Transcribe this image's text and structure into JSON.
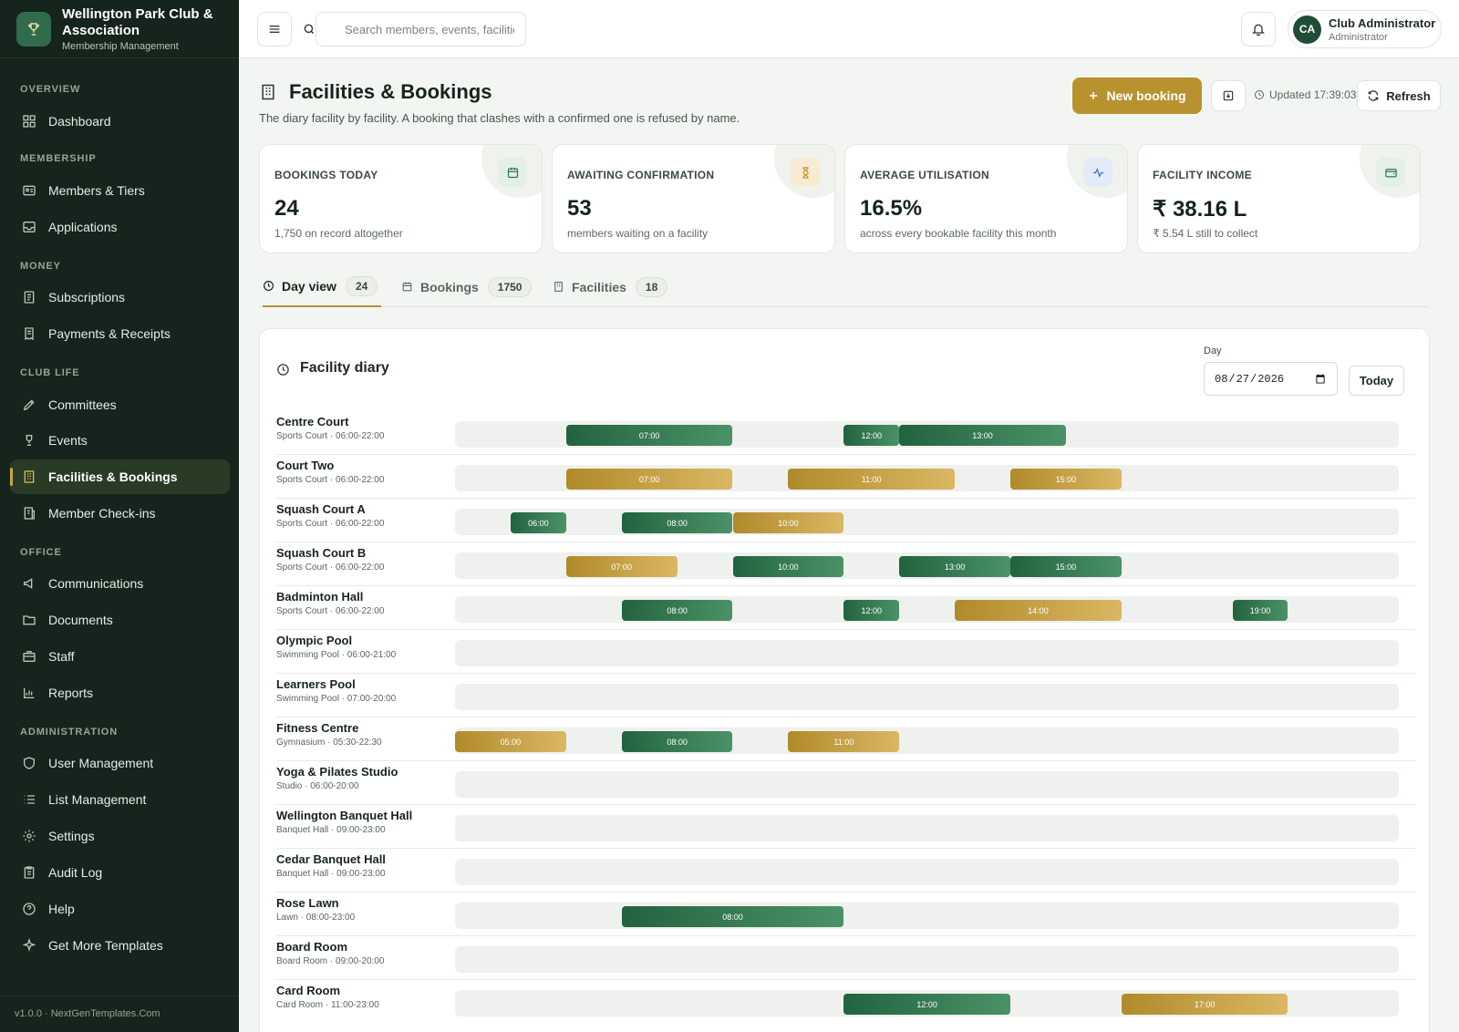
{
  "brand": {
    "name": "Wellington Park Club & Association",
    "subtitle": "Membership Management"
  },
  "nav": {
    "sections": [
      "OVERVIEW",
      "MEMBERSHIP",
      "MONEY",
      "CLUB LIFE",
      "OFFICE",
      "ADMINISTRATION"
    ],
    "items": [
      {
        "label": "Dashboard",
        "icon": "dashboard-icon"
      },
      {
        "label": "Members & Tiers",
        "icon": "id-card-icon"
      },
      {
        "label": "Applications",
        "icon": "inbox-icon"
      },
      {
        "label": "Subscriptions",
        "icon": "document-icon"
      },
      {
        "label": "Payments & Receipts",
        "icon": "receipt-icon"
      },
      {
        "label": "Committees",
        "icon": "pen-icon"
      },
      {
        "label": "Events",
        "icon": "trophy-icon"
      },
      {
        "label": "Facilities & Bookings",
        "icon": "building-icon",
        "active": true
      },
      {
        "label": "Member Check-ins",
        "icon": "check-in-icon"
      },
      {
        "label": "Communications",
        "icon": "megaphone-icon"
      },
      {
        "label": "Documents",
        "icon": "folder-icon"
      },
      {
        "label": "Staff",
        "icon": "briefcase-icon"
      },
      {
        "label": "Reports",
        "icon": "bar-chart-icon"
      },
      {
        "label": "User Management",
        "icon": "shield-icon"
      },
      {
        "label": "List Management",
        "icon": "list-icon"
      },
      {
        "label": "Settings",
        "icon": "gear-icon"
      },
      {
        "label": "Audit Log",
        "icon": "clipboard-icon"
      },
      {
        "label": "Help",
        "icon": "help-icon"
      },
      {
        "label": "Get More Templates",
        "icon": "sparkle-icon"
      }
    ],
    "footer": "v1.0.0 · NextGenTemplates.Com"
  },
  "topbar": {
    "search_placeholder": "Search members, events, facilities...",
    "user": {
      "initials": "CA",
      "name": "Club Administrator",
      "role": "Administrator"
    }
  },
  "page": {
    "title": "Facilities & Bookings",
    "subtitle": "The diary facility by facility. A booking that clashes with a confirmed one is refused by name.",
    "new_booking": "New booking",
    "updated": "Updated 17:39:03",
    "refresh": "Refresh"
  },
  "stats": [
    {
      "label": "BOOKINGS TODAY",
      "value": "24",
      "note": "1,750 on record altogether",
      "icon": "calendar-icon",
      "accent": "#2f7a52"
    },
    {
      "label": "AWAITING CONFIRMATION",
      "value": "53",
      "note": "members waiting on a facility",
      "icon": "hourglass-icon",
      "accent": "#c9982a"
    },
    {
      "label": "AVERAGE UTILISATION",
      "value": "16.5%",
      "note": "across every bookable facility this month",
      "icon": "activity-icon",
      "accent": "#3f6fd1"
    },
    {
      "label": "FACILITY INCOME",
      "value": "₹ 38.16 L",
      "note": "₹ 5.54 L still to collect",
      "icon": "wallet-icon",
      "accent": "#2f7a52"
    }
  ],
  "tabs": [
    {
      "label": "Day view",
      "count": "24",
      "icon": "clock-icon",
      "active": true
    },
    {
      "label": "Bookings",
      "count": "1750",
      "icon": "calendar-icon"
    },
    {
      "label": "Facilities",
      "count": "18",
      "icon": "building-icon"
    }
  ],
  "diary": {
    "title": "Facility diary",
    "day_label": "Day",
    "day_value": "2026-08-27",
    "today": "Today",
    "axis_start_hour": 5,
    "axis_end_hour": 22,
    "status_colors": {
      "confirmed": "#2f7a52",
      "pending": "#c9a23f"
    },
    "facilities": [
      {
        "name": "Centre Court",
        "meta": "Sports Court · 06:00-22:00",
        "bookings": [
          {
            "start": "07:00",
            "hours": 3,
            "status": "confirmed"
          },
          {
            "start": "12:00",
            "hours": 1,
            "status": "confirmed"
          },
          {
            "start": "13:00",
            "hours": 3,
            "status": "confirmed"
          }
        ]
      },
      {
        "name": "Court Two",
        "meta": "Sports Court · 06:00-22:00",
        "bookings": [
          {
            "start": "07:00",
            "hours": 3,
            "status": "pending"
          },
          {
            "start": "11:00",
            "hours": 3,
            "status": "pending"
          },
          {
            "start": "15:00",
            "hours": 2,
            "status": "pending"
          }
        ]
      },
      {
        "name": "Squash Court A",
        "meta": "Sports Court · 06:00-22:00",
        "bookings": [
          {
            "start": "06:00",
            "hours": 1,
            "status": "confirmed"
          },
          {
            "start": "08:00",
            "hours": 2,
            "status": "confirmed"
          },
          {
            "start": "10:00",
            "hours": 2,
            "status": "pending"
          }
        ]
      },
      {
        "name": "Squash Court B",
        "meta": "Sports Court · 06:00-22:00",
        "bookings": [
          {
            "start": "07:00",
            "hours": 2,
            "status": "pending"
          },
          {
            "start": "10:00",
            "hours": 2,
            "status": "confirmed"
          },
          {
            "start": "13:00",
            "hours": 2,
            "status": "confirmed"
          },
          {
            "start": "15:00",
            "hours": 2,
            "status": "confirmed"
          }
        ]
      },
      {
        "name": "Badminton Hall",
        "meta": "Sports Court · 06:00-22:00",
        "bookings": [
          {
            "start": "08:00",
            "hours": 2,
            "status": "confirmed"
          },
          {
            "start": "12:00",
            "hours": 1,
            "status": "confirmed"
          },
          {
            "start": "14:00",
            "hours": 3,
            "status": "pending"
          },
          {
            "start": "19:00",
            "hours": 1,
            "status": "confirmed"
          }
        ]
      },
      {
        "name": "Olympic Pool",
        "meta": "Swimming Pool · 06:00-21:00",
        "bookings": []
      },
      {
        "name": "Learners Pool",
        "meta": "Swimming Pool · 07:00-20:00",
        "bookings": []
      },
      {
        "name": "Fitness Centre",
        "meta": "Gymnasium · 05:30-22:30",
        "bookings": [
          {
            "start": "05:00",
            "hours": 2,
            "status": "pending"
          },
          {
            "start": "08:00",
            "hours": 2,
            "status": "confirmed"
          },
          {
            "start": "11:00",
            "hours": 2,
            "status": "pending"
          }
        ]
      },
      {
        "name": "Yoga & Pilates Studio",
        "meta": "Studio · 06:00-20:00",
        "bookings": []
      },
      {
        "name": "Wellington Banquet Hall",
        "meta": "Banquet Hall · 09:00-23:00",
        "bookings": []
      },
      {
        "name": "Cedar Banquet Hall",
        "meta": "Banquet Hall · 09:00-23:00",
        "bookings": []
      },
      {
        "name": "Rose Lawn",
        "meta": "Lawn · 08:00-23:00",
        "bookings": [
          {
            "start": "08:00",
            "hours": 4,
            "status": "confirmed"
          }
        ]
      },
      {
        "name": "Board Room",
        "meta": "Board Room · 09:00-20:00",
        "bookings": []
      },
      {
        "name": "Card Room",
        "meta": "Card Room · 11:00-23:00",
        "bookings": [
          {
            "start": "12:00",
            "hours": 3,
            "status": "confirmed"
          },
          {
            "start": "17:00",
            "hours": 3,
            "status": "pending"
          }
        ]
      }
    ]
  }
}
